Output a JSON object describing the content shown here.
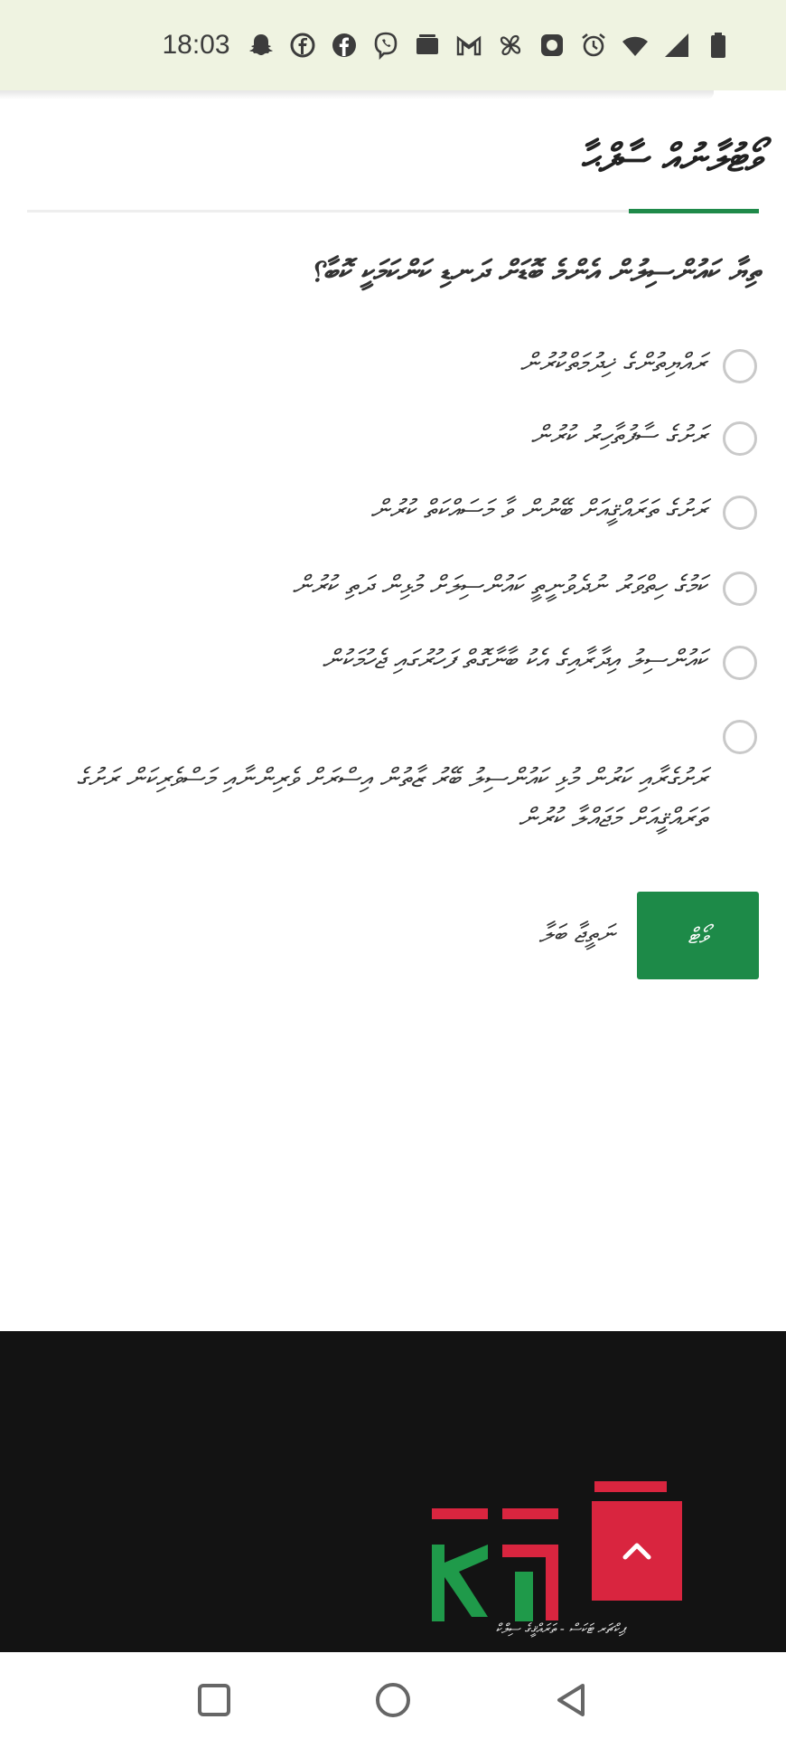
{
  "status_bar": {
    "time": "18:03",
    "icons": [
      "snapchat-icon",
      "facebook-outline-icon",
      "facebook-icon",
      "viber-icon",
      "messages-icon",
      "gmail-icon",
      "pinwheel-icon",
      "photo-icon",
      "alarm-icon",
      "wifi-icon",
      "signal-icon",
      "battery-icon"
    ]
  },
  "poll": {
    "title": "ވޯޓުލާނުއް ސާފްޙާ",
    "question": "ތިޔާ ކައުންސިލުން އެންމެ ބޮޑަށް ދަނޑި ކަންކަމަކީ ކޮބާ؟",
    "options": [
      {
        "label": "ރައްޔިތުންގެ ޚިދުމަތްކުރުން"
      },
      {
        "label": "ރަށުގެ ސާފުތާހިރު ކުރުން"
      },
      {
        "label": "ރަށުގެ ތަރައްޤީއަށް ބޭނުން ވާ މަސައްކަތް ކުރުން"
      },
      {
        "label": "ކަމުގެ ހިތްވަރު ނުދެވުނީތީ ކައުންސިލަށް މުޅިން ދަތި ކުރުން"
      },
      {
        "label": "ކައުންސިލު އިދާރާއިގެ އެކު ބާނާގޮތް ފަހުރުގައި ޖެހުމަކުން"
      },
      {
        "label": "ރަށުގެރާއި ކަރުން މުޅި ކައުންސިލު ބޭރު ޒާތުން އިސްރަށް ވެރިންނާއި މަސްވެރިކަން ރަށުގެ ތަރައްޤީއަށް މަޖައްލާ ކުރުން"
      }
    ],
    "submit_label": "ވޯޓް",
    "results_label": "ނަތީޖާ ބަލާ"
  },
  "footer": {
    "logo_tagline": "ޕިކްޗަރ ޓަކަސް - ތަރައްޤީގެ ސިލްކް"
  },
  "colors": {
    "accent": "#1d8a48",
    "status_bar_bg": "#eff3e1",
    "footer_bg": "#131313",
    "logo_red": "#d9253f",
    "logo_green": "#1f9a4a"
  }
}
